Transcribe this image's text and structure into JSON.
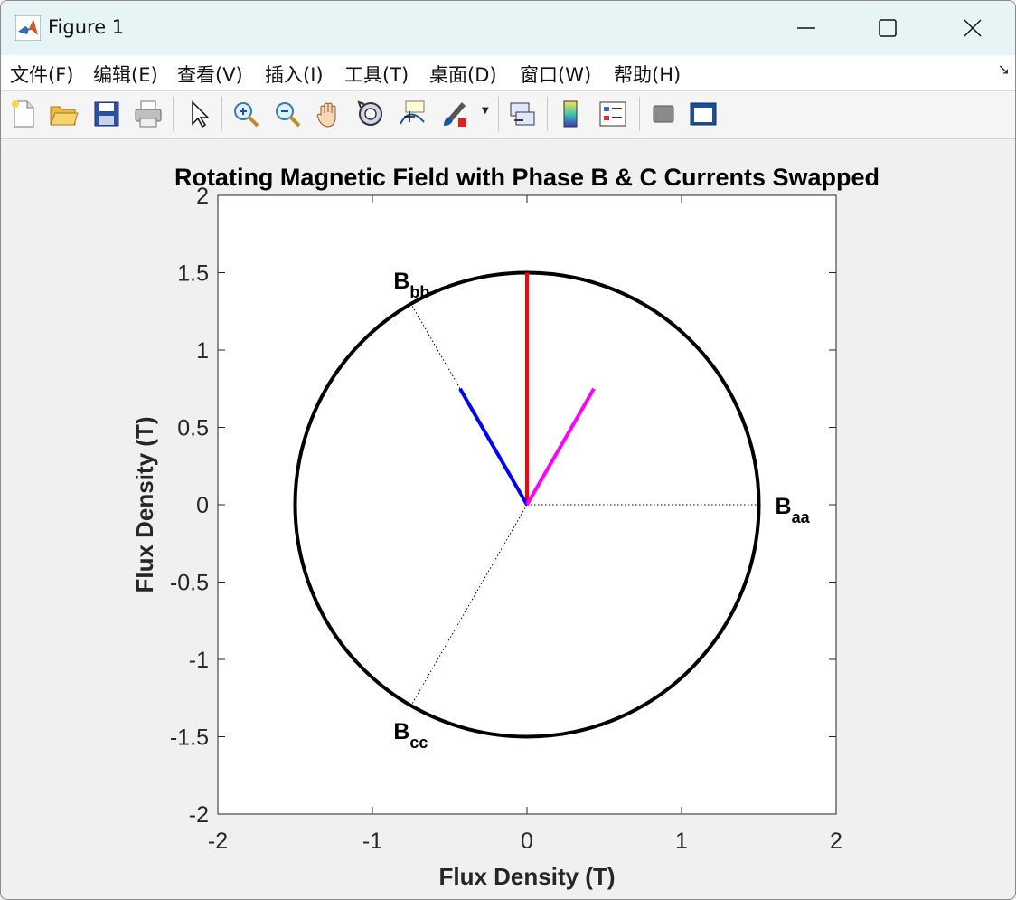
{
  "window": {
    "title": "Figure 1"
  },
  "menu": [
    "文件(F)",
    "编辑(E)",
    "查看(V)",
    "插入(I)",
    "工具(T)",
    "桌面(D)",
    "窗口(W)",
    "帮助(H)"
  ],
  "toolbar": {
    "buttons": [
      "new-figure-icon",
      "open-folder-icon",
      "save-icon",
      "print-icon",
      "pointer-icon",
      "zoom-in-icon",
      "zoom-out-icon",
      "pan-hand-icon",
      "rotate-3d-icon",
      "data-cursor-icon",
      "brush-icon",
      "link-plot-icon",
      "colorbar-icon",
      "legend-icon",
      "hide-plot-tools-icon",
      "show-plot-tools-icon"
    ]
  },
  "chart_data": {
    "type": "line",
    "title": "Rotating Magnetic Field with Phase B & C Currents Swapped",
    "xlabel": "Flux Density (T)",
    "ylabel": "Flux Density (T)",
    "xlim": [
      -2,
      2
    ],
    "ylim": [
      -2,
      2
    ],
    "xticks": [
      "-2",
      "-1",
      "0",
      "1",
      "2"
    ],
    "yticks": [
      "-2",
      "-1.5",
      "-1",
      "-0.5",
      "0",
      "0.5",
      "1",
      "1.5",
      "2"
    ],
    "circle": {
      "radius": 1.5,
      "color": "#000000"
    },
    "reference_axes": [
      {
        "label": "B",
        "sub": "aa",
        "angle_deg": 0
      },
      {
        "label": "B",
        "sub": "bb",
        "angle_deg": 120
      },
      {
        "label": "B",
        "sub": "cc",
        "angle_deg": 240
      }
    ],
    "vectors": [
      {
        "color": "#ff0000",
        "x": 0,
        "y": 1.5
      },
      {
        "color": "#0000ff",
        "x": -0.433,
        "y": 0.75
      },
      {
        "color": "#ff00ff",
        "x": 0.433,
        "y": 0.75
      }
    ]
  }
}
